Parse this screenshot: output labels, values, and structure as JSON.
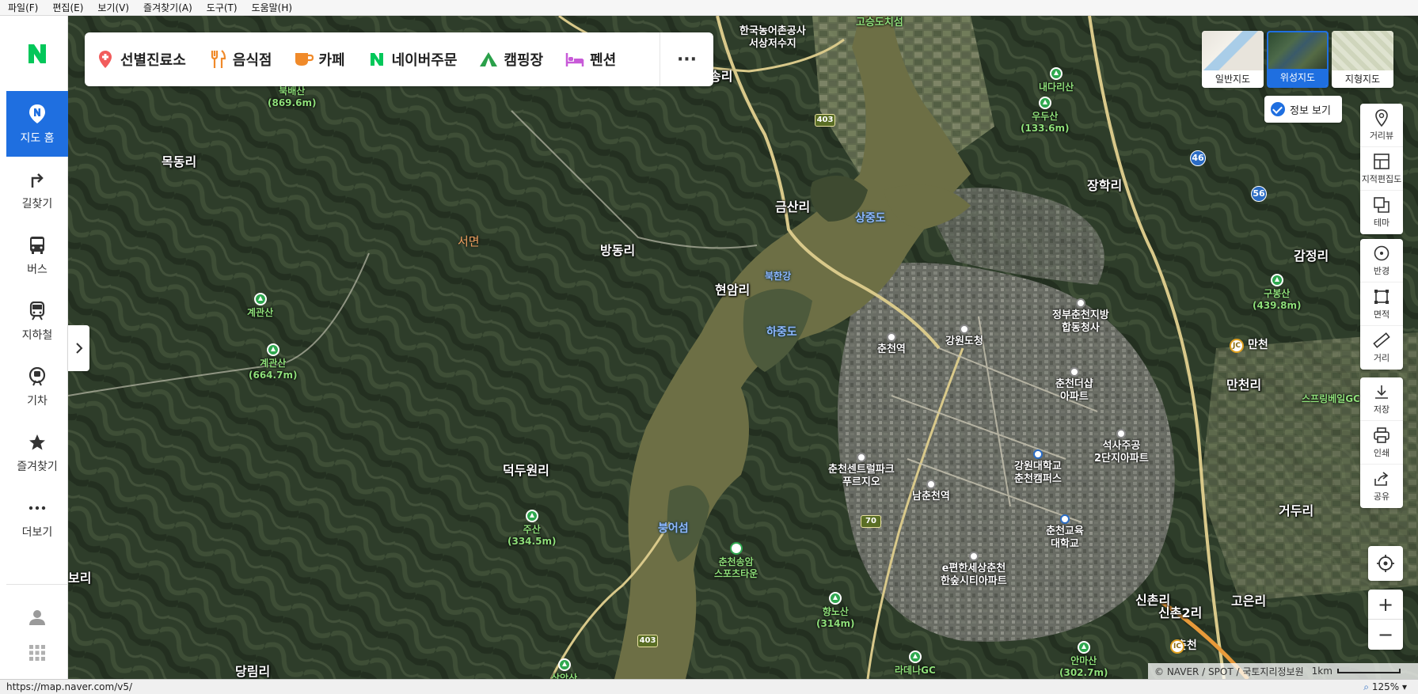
{
  "menu": [
    "파일(F)",
    "편집(E)",
    "보기(V)",
    "즐겨찾기(A)",
    "도구(T)",
    "도움말(H)"
  ],
  "sidebar": {
    "logo": "N",
    "items": [
      {
        "label": "지도 홈",
        "icon": "map-home-icon"
      },
      {
        "label": "길찾기",
        "icon": "directions-icon"
      },
      {
        "label": "버스",
        "icon": "bus-icon"
      },
      {
        "label": "지하철",
        "icon": "subway-icon"
      },
      {
        "label": "기차",
        "icon": "train-icon"
      },
      {
        "label": "즐겨찾기",
        "icon": "star-icon"
      },
      {
        "label": "더보기",
        "icon": "more-icon"
      }
    ]
  },
  "categories": [
    {
      "label": "선별진료소",
      "icon": "clinic-pin-icon",
      "color": "#f25c5c"
    },
    {
      "label": "음식점",
      "icon": "fork-knife-icon",
      "color": "#f08a2a"
    },
    {
      "label": "카페",
      "icon": "coffee-cup-icon",
      "color": "#f08a2a"
    },
    {
      "label": "네이버주문",
      "icon": "naver-n-icon",
      "color": "#03c75a"
    },
    {
      "label": "캠핑장",
      "icon": "tent-icon",
      "color": "#2aa04a"
    },
    {
      "label": "펜션",
      "icon": "bed-icon",
      "color": "#c85ad8"
    }
  ],
  "category_more": "···",
  "map_types": [
    {
      "label": "일반지도",
      "active": false
    },
    {
      "label": "위성지도",
      "active": true
    },
    {
      "label": "지형지도",
      "active": false
    }
  ],
  "info_toggle": "정보 보기",
  "tools_group1": [
    {
      "label": "거리뷰",
      "icon": "street-view-icon"
    },
    {
      "label": "지적편집도",
      "icon": "cadastral-icon"
    },
    {
      "label": "테마",
      "icon": "theme-icon"
    }
  ],
  "tools_group2": [
    {
      "label": "반경",
      "icon": "radius-icon"
    },
    {
      "label": "면적",
      "icon": "area-icon"
    },
    {
      "label": "거리",
      "icon": "ruler-icon"
    }
  ],
  "tools_group3": [
    {
      "label": "저장",
      "icon": "download-icon"
    },
    {
      "label": "인쇄",
      "icon": "print-icon"
    },
    {
      "label": "공유",
      "icon": "share-icon"
    }
  ],
  "zoom": {
    "in": "+",
    "out": "−"
  },
  "copyright": "© NAVER / SPOT / 국토지리정보원",
  "scale_label": "1km",
  "status_url": "https://map.naver.com/v5/",
  "zoom_level": "125%",
  "map_labels": {
    "places": [
      {
        "text": "목동리"
      },
      {
        "text": "금산리"
      },
      {
        "text": "방동리"
      },
      {
        "text": "현암리"
      },
      {
        "text": "장학리"
      },
      {
        "text": "감정리"
      },
      {
        "text": "만천리"
      },
      {
        "text": "덕두원리"
      },
      {
        "text": "거두리"
      },
      {
        "text": "신촌리"
      },
      {
        "text": "신촌2리"
      },
      {
        "text": "고은리"
      },
      {
        "text": "당림리"
      },
      {
        "text": "송리"
      },
      {
        "text": "보리"
      },
      {
        "text": "만천"
      },
      {
        "text": "춘천"
      }
    ],
    "small_places": [
      {
        "text": "한국농어촌공사\n서상저수지"
      },
      {
        "text": "춘천역"
      },
      {
        "text": "강원도청"
      },
      {
        "text": "정부춘천지방\n합동청사"
      },
      {
        "text": "춘천더샵\n아파트"
      },
      {
        "text": "석사주공\n2단지아파트"
      },
      {
        "text": "강원대학교\n춘천캠퍼스"
      },
      {
        "text": "춘천센트럴파크\n푸르지오"
      },
      {
        "text": "남춘천역"
      },
      {
        "text": "춘천교육\n대학교"
      },
      {
        "text": "e편한세상춘천\n한숲시티아파트"
      }
    ],
    "water": [
      {
        "text": "상중도"
      },
      {
        "text": "북한강"
      },
      {
        "text": "하중도"
      },
      {
        "text": "붕어섬"
      }
    ],
    "district": [
      {
        "text": "서면"
      }
    ],
    "mountains": [
      {
        "text": "북배산\n(869.6m)"
      },
      {
        "text": "계관산"
      },
      {
        "text": "계관산\n(664.7m)"
      },
      {
        "text": "주산\n(334.5m)"
      },
      {
        "text": "향노산\n(314m)"
      },
      {
        "text": "우두산\n(133.6m)"
      },
      {
        "text": "내다리산"
      },
      {
        "text": "구봉산\n(439.8m)"
      },
      {
        "text": "안마산\n(302.7m)"
      },
      {
        "text": "삼악산"
      },
      {
        "text": "고승도치섬"
      }
    ],
    "pois_green": [
      {
        "text": "춘천송암\n스포츠타운"
      },
      {
        "text": "라데나GC"
      },
      {
        "text": "스프링베일GC"
      }
    ],
    "shields": [
      "403",
      "403",
      "46",
      "56",
      "70",
      "JC",
      "IC"
    ]
  }
}
